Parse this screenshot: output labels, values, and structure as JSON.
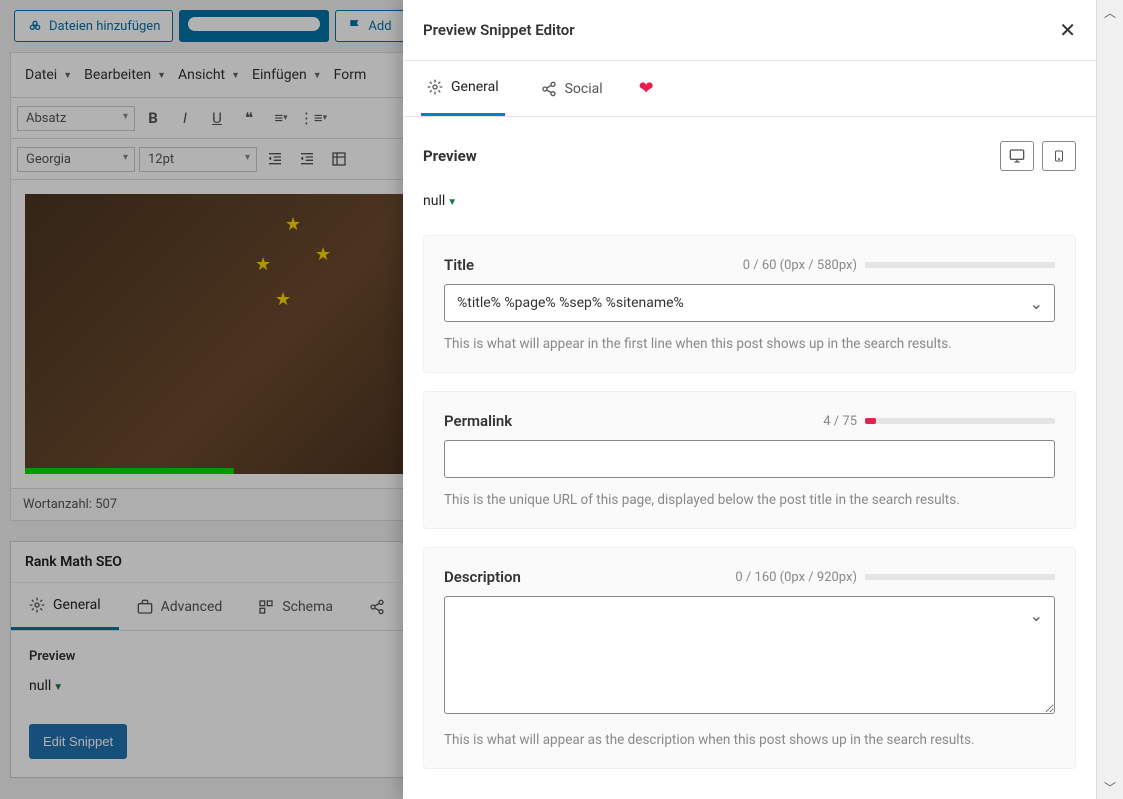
{
  "topButtons": {
    "addFiles": "Dateien hinzufügen",
    "addOther": "Add"
  },
  "editorMenu": [
    "Datei",
    "Bearbeiten",
    "Ansicht",
    "Einfügen",
    "Form"
  ],
  "toolbar": {
    "format": "Absatz",
    "font": "Georgia",
    "size": "12pt"
  },
  "wordCount": "Wortanzahl: 507",
  "rankmath": {
    "title": "Rank Math SEO",
    "tabs": {
      "general": "General",
      "advanced": "Advanced",
      "schema": "Schema"
    },
    "preview": "Preview",
    "nullLabel": "null",
    "editSnippet": "Edit Snippet"
  },
  "modal": {
    "title": "Preview Snippet Editor",
    "tabGeneral": "General",
    "tabSocial": "Social",
    "previewLabel": "Preview",
    "nullLabel": "null",
    "titleField": {
      "label": "Title",
      "counter": "0 / 60 (0px / 580px)",
      "value": "%title% %page% %sep% %sitename%",
      "help": "This is what will appear in the first line when this post shows up in the search results."
    },
    "permalinkField": {
      "label": "Permalink",
      "counter": "4 / 75",
      "value": "",
      "help": "This is the unique URL of this page, displayed below the post title in the search results."
    },
    "descriptionField": {
      "label": "Description",
      "counter": "0 / 160 (0px / 920px)",
      "value": "",
      "help": "This is what will appear as the description when this post shows up in the search results."
    }
  }
}
